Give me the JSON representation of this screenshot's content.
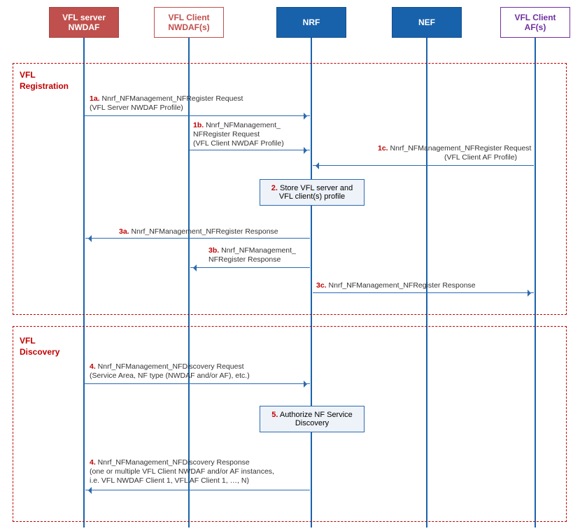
{
  "participants": {
    "vfl_server": "VFL server NWDAF",
    "vfl_client_nwdaf": "VFL Client NWDAF(s)",
    "nrf": "NRF",
    "nef": "NEF",
    "vfl_client_af": "VFL Client AF(s)"
  },
  "phases": {
    "registration": "VFL Registration",
    "discovery": "VFL Discovery"
  },
  "messages": {
    "m1a_num": "1a.",
    "m1a": " Nnrf_NFManagement_NFRegister Request",
    "m1a_sub": "(VFL Server NWDAF Profile)",
    "m1b_num": "1b.",
    "m1b": " Nnrf_NFManagement_",
    "m1b_l2": "NFRegister Request",
    "m1b_sub": "(VFL Client NWDAF Profile)",
    "m1c_num": "1c.",
    "m1c": " Nnrf_NFManagement_NFRegister Request",
    "m1c_sub": "(VFL Client AF Profile)",
    "m2_num": "2.",
    "m2": " Store VFL server and VFL client(s) profile",
    "m3a_num": "3a.",
    "m3a": " Nnrf_NFManagement_NFRegister Response",
    "m3b_num": "3b.",
    "m3b": " Nnrf_NFManagement_",
    "m3b_l2": "NFRegister Response",
    "m3c_num": "3c.",
    "m3c": " Nnrf_NFManagement_NFRegister Response",
    "m4_num": "4.",
    "m4": " Nnrf_NFManagement_NFDiscovery Request",
    "m4_sub": "(Service Area, NF type (NWDAF and/or AF), etc.)",
    "m5_num": "5.",
    "m5": " Authorize NF Service Discovery",
    "m6_num": "4.",
    "m6": " Nnrf_NFManagement_NFDiscovery Response",
    "m6_sub1": "(one or multiple VFL Client NWDAF and/or AF instances,",
    "m6_sub2": "i.e. VFL NWDAF Client 1, VFL AF Client 1, …, N)"
  }
}
